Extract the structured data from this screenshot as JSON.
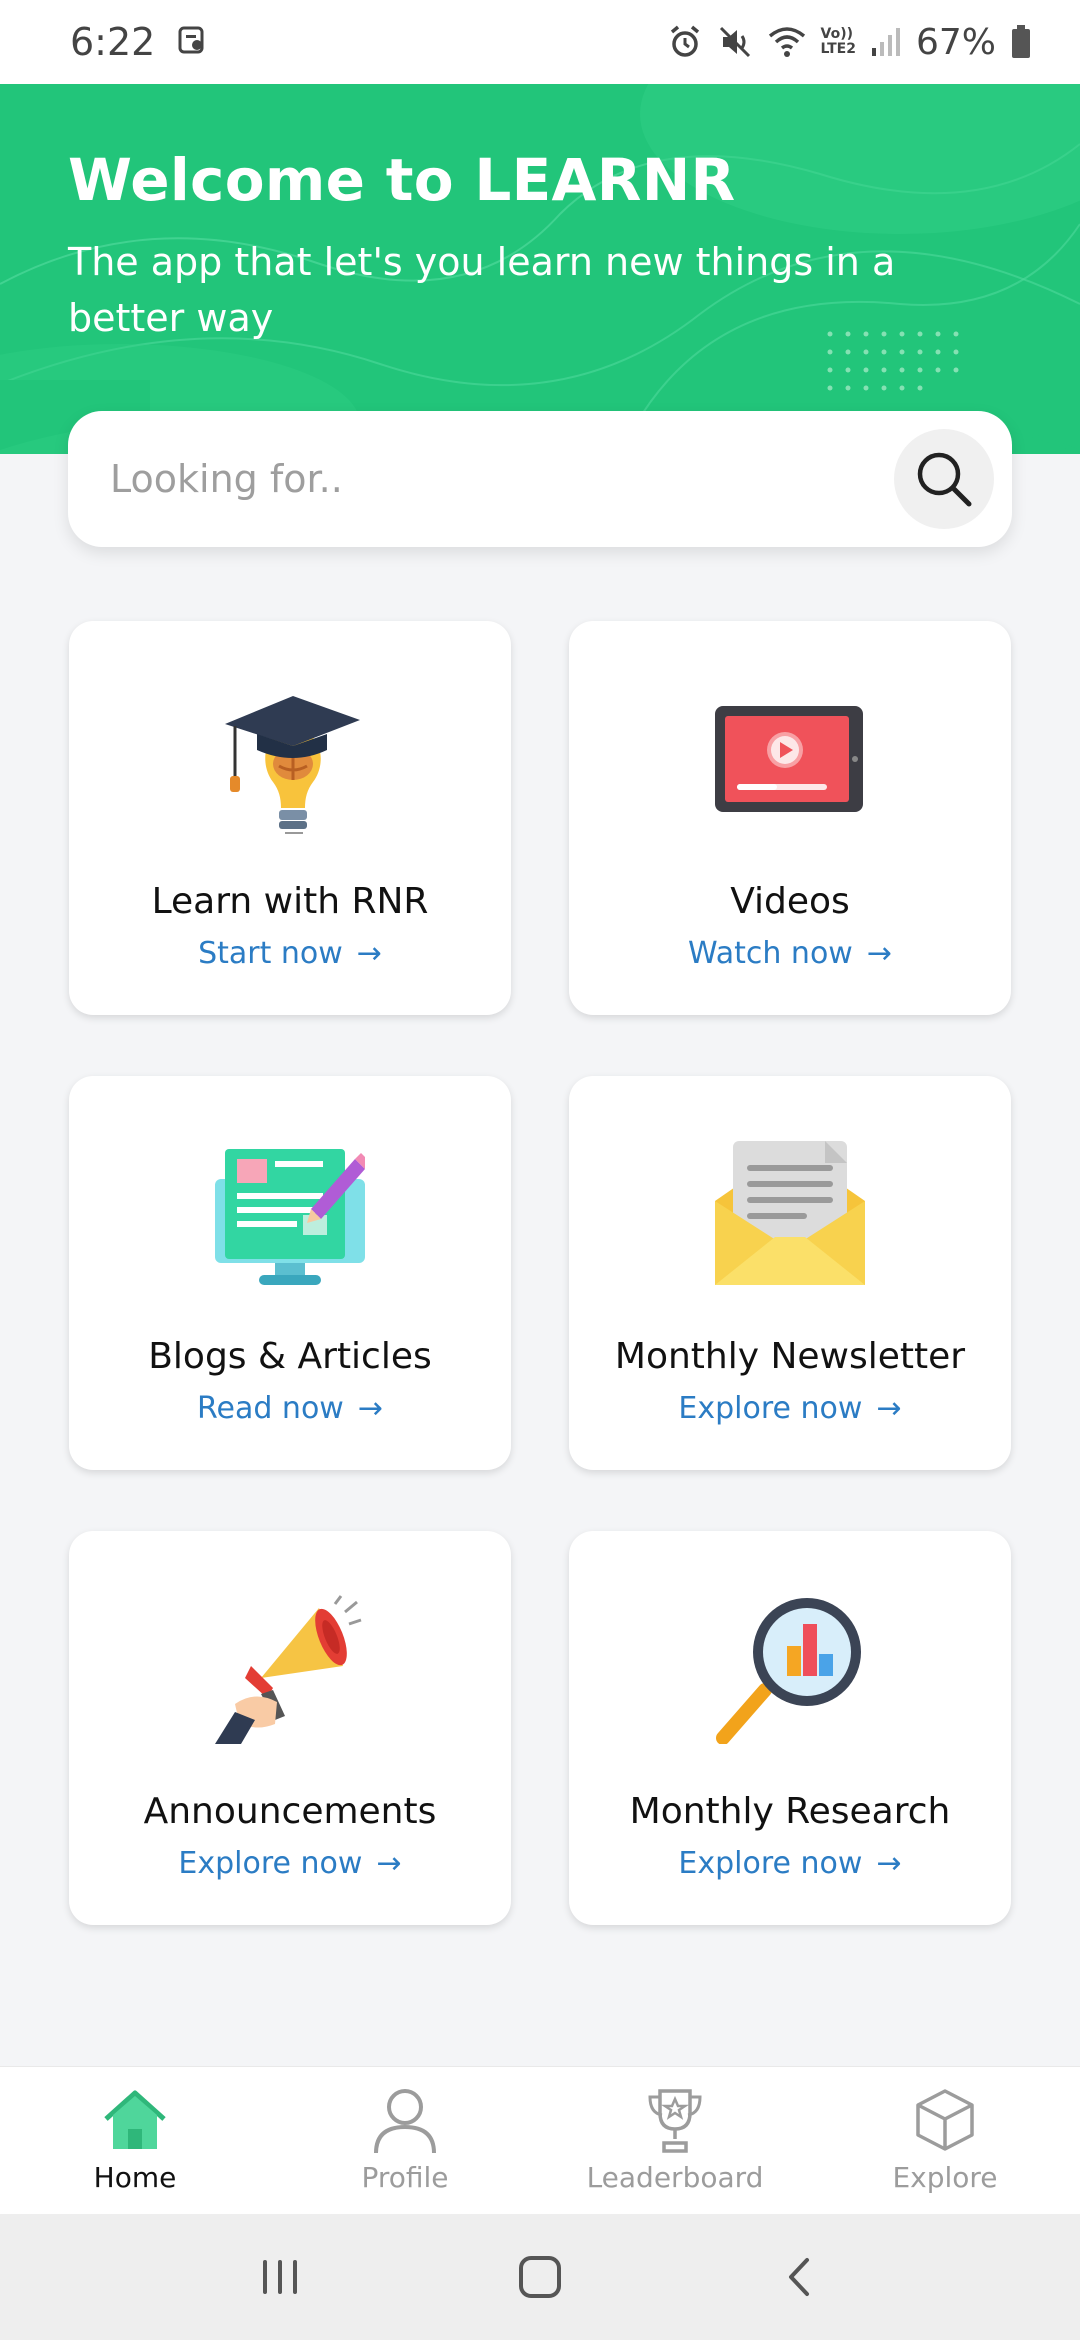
{
  "status_bar": {
    "time": "6:22",
    "lte_label": "LTE2",
    "volte_label": "Vo))",
    "battery": "67%"
  },
  "header": {
    "title": "Welcome to LEARNR",
    "subtitle": "The app that let's you learn new things in a better way"
  },
  "search": {
    "placeholder": "Looking for.."
  },
  "cards": [
    {
      "title": "Learn with RNR",
      "link": "Start now",
      "icon": "graduation-bulb-icon"
    },
    {
      "title": "Videos",
      "link": "Watch now",
      "icon": "video-player-icon"
    },
    {
      "title": "Blogs & Articles",
      "link": "Read now",
      "icon": "blog-monitor-icon"
    },
    {
      "title": "Monthly Newsletter",
      "link": "Explore now",
      "icon": "envelope-icon"
    },
    {
      "title": "Announcements",
      "link": "Explore now",
      "icon": "megaphone-icon"
    },
    {
      "title": "Monthly Research",
      "link": "Explore now",
      "icon": "magnifier-chart-icon"
    }
  ],
  "bottom_nav": [
    {
      "label": "Home",
      "icon": "home-icon",
      "active": true
    },
    {
      "label": "Profile",
      "icon": "profile-icon",
      "active": false
    },
    {
      "label": "Leaderboard",
      "icon": "trophy-icon",
      "active": false
    },
    {
      "label": "Explore",
      "icon": "cube-icon",
      "active": false
    }
  ],
  "colors": {
    "header_green": "#22c57a",
    "link_blue": "#2b7cc4",
    "home_green": "#4fd69b"
  },
  "arrow_glyph": "→"
}
